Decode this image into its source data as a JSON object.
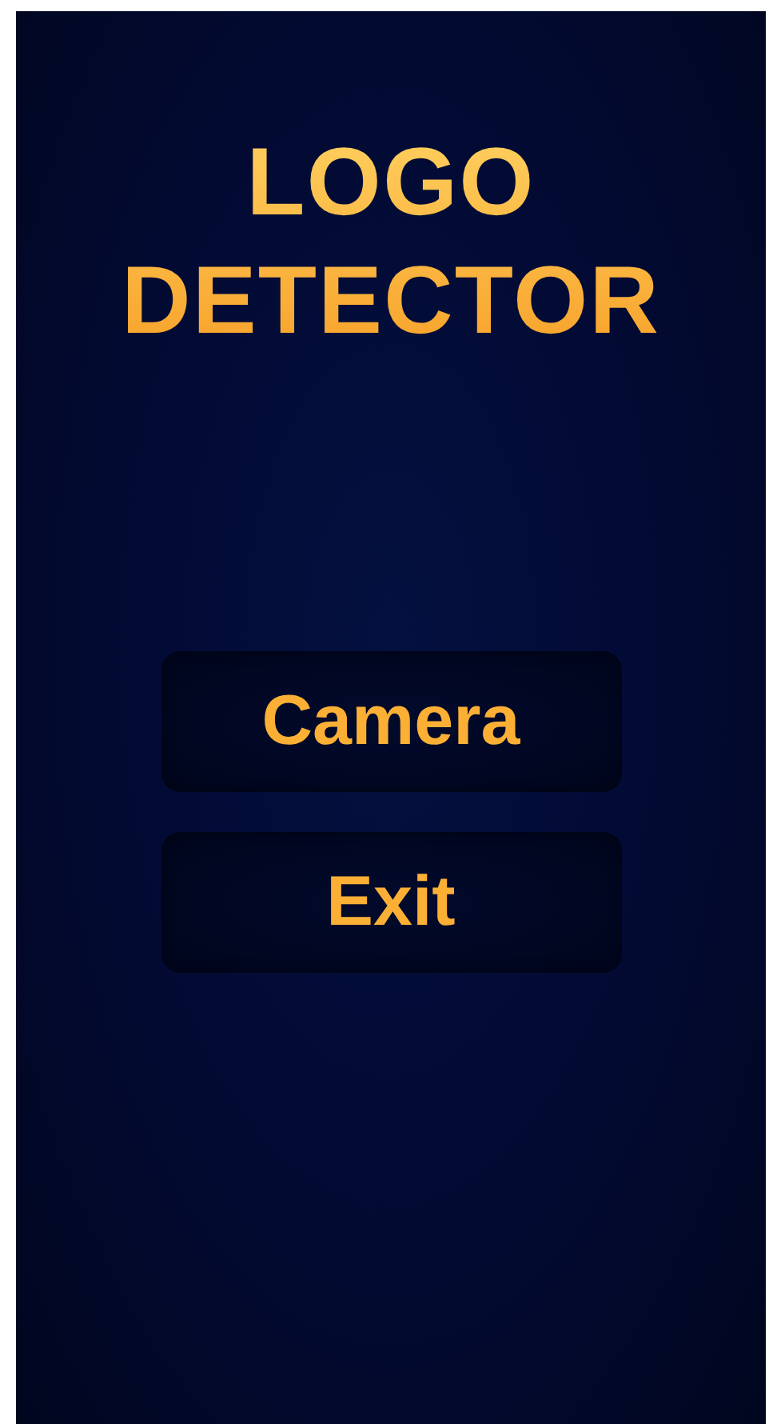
{
  "title": "LOGO DETECTOR",
  "buttons": [
    {
      "label": "Camera"
    },
    {
      "label": "Exit"
    }
  ]
}
